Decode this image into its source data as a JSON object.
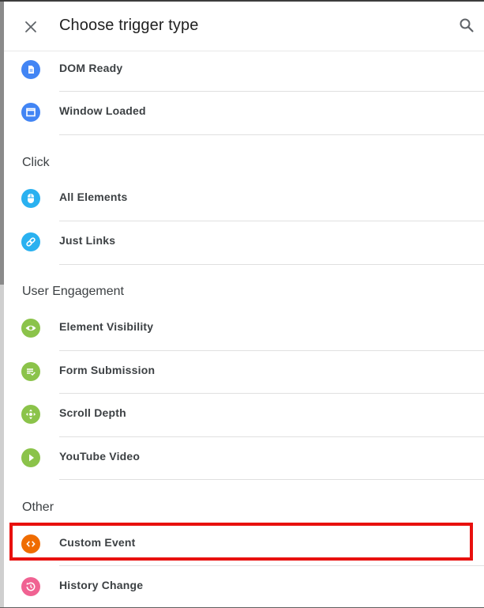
{
  "header": {
    "title": "Choose trigger type",
    "close_icon": "close-icon",
    "search_icon": "search-icon"
  },
  "colors": {
    "blue": "#4285f4",
    "light_blue": "#2ab1f0",
    "green": "#8bc34a",
    "orange": "#ef6c00",
    "pink": "#f06292",
    "highlight": "#e8100e"
  },
  "groups": {
    "page_view": {
      "items": [
        {
          "label": "DOM Ready",
          "icon": "document-icon"
        },
        {
          "label": "Window Loaded",
          "icon": "window-icon"
        }
      ]
    },
    "click": {
      "title": "Click",
      "items": [
        {
          "label": "All Elements",
          "icon": "mouse-icon"
        },
        {
          "label": "Just Links",
          "icon": "link-icon"
        }
      ]
    },
    "user_engagement": {
      "title": "User Engagement",
      "items": [
        {
          "label": "Element Visibility",
          "icon": "eye-icon"
        },
        {
          "label": "Form Submission",
          "icon": "form-check-icon"
        },
        {
          "label": "Scroll Depth",
          "icon": "move-icon"
        },
        {
          "label": "YouTube Video",
          "icon": "play-icon"
        }
      ]
    },
    "other": {
      "title": "Other",
      "items": [
        {
          "label": "Custom Event",
          "icon": "code-icon",
          "highlighted": true
        },
        {
          "label": "History Change",
          "icon": "history-icon"
        }
      ]
    }
  }
}
